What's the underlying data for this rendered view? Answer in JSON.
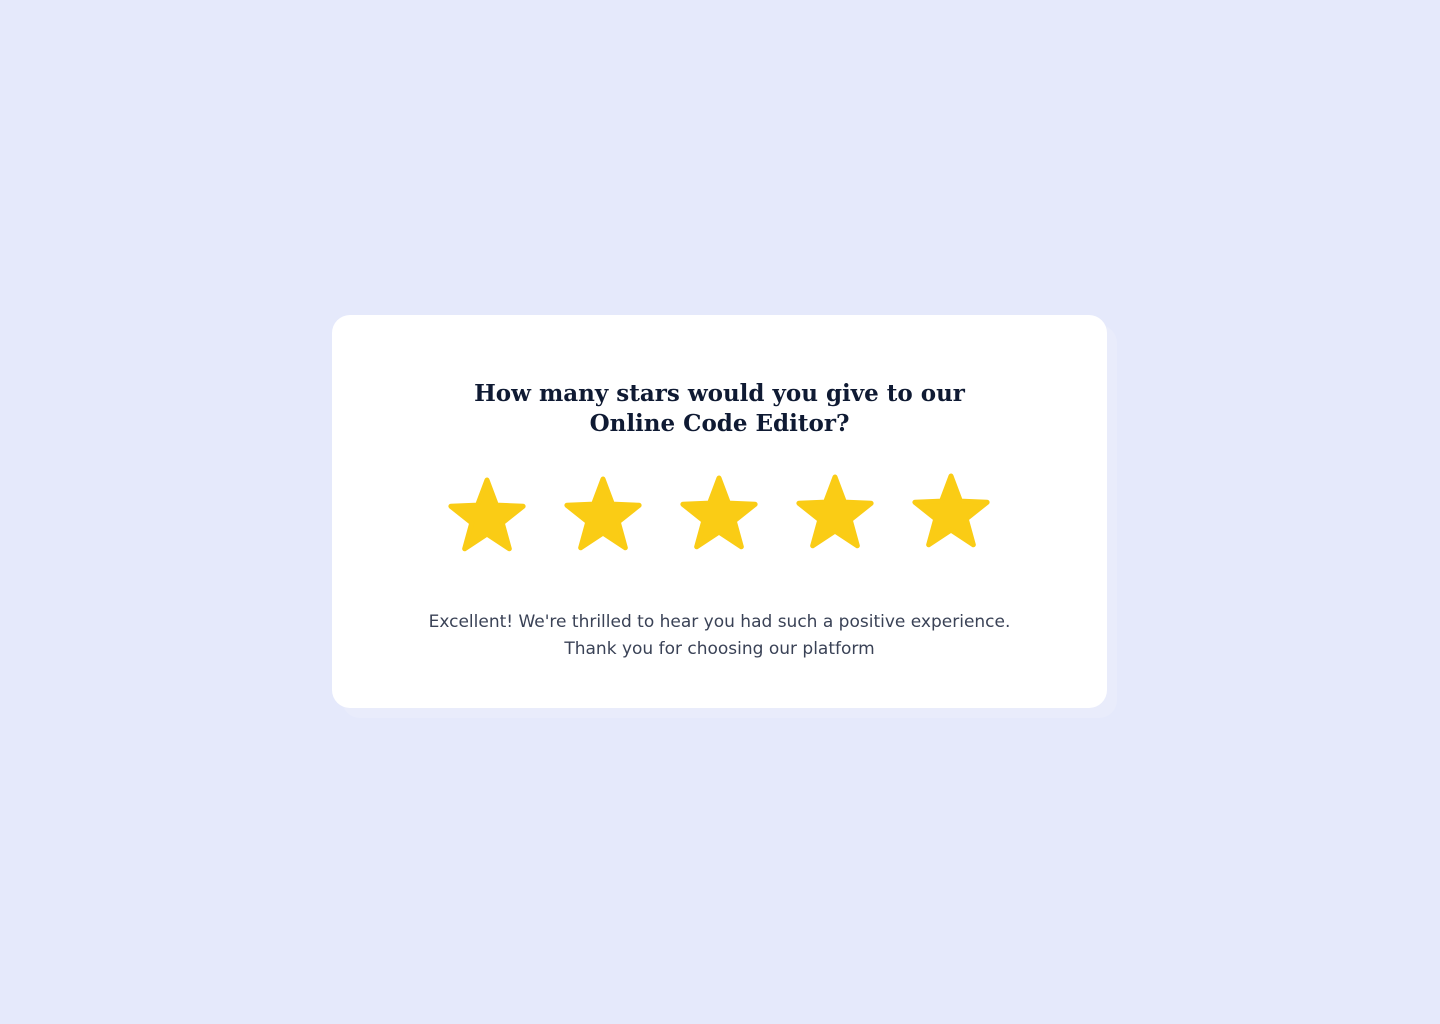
{
  "page": {
    "background_color": "#e5e9fb"
  },
  "rating_card": {
    "title_line_1": "How many stars would you give to our",
    "title_line_2": "Online Code Editor?",
    "rating": {
      "value": 5,
      "max": 5
    },
    "star_color": "#facc15",
    "star_icon": "star-icon",
    "feedback_line_1": "Excellent! We're thrilled to hear you had such a positive experience.",
    "feedback_line_2": "Thank you for choosing our platform"
  }
}
